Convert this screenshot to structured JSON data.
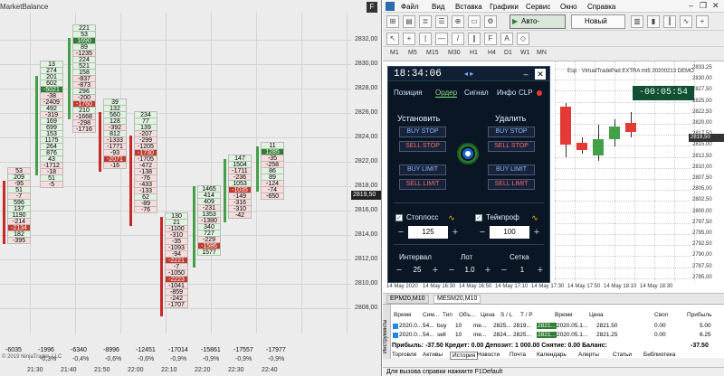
{
  "left_chart": {
    "title": "MarketBalance",
    "f_button": "F",
    "price_axis": [
      "2832,00",
      "2830,00",
      "2828,00",
      "2826,00",
      "2824,00",
      "2822,00",
      "2818,00",
      "2816,00",
      "2814,00",
      "2812,00",
      "2810,00",
      "2808,00"
    ],
    "current_price": "2819,50",
    "columns": [
      {
        "cells": [
          {
            "v": "53",
            "t": "n"
          },
          {
            "v": "209",
            "t": "p"
          },
          {
            "v": "-95",
            "t": "n"
          },
          {
            "v": "51",
            "t": "p"
          },
          {
            "v": "-7",
            "t": "n"
          },
          {
            "v": "596",
            "t": "p"
          },
          {
            "v": "137",
            "t": "p"
          },
          {
            "v": "1190",
            "t": "p"
          },
          {
            "v": "-214",
            "t": "n"
          },
          {
            "v": "-2134",
            "t": "hr"
          },
          {
            "v": "182",
            "t": "p"
          },
          {
            "v": "-395",
            "t": "n"
          }
        ]
      },
      {
        "cells": [
          {
            "v": "13",
            "t": "p"
          },
          {
            "v": "274",
            "t": "p"
          },
          {
            "v": "201",
            "t": "p"
          },
          {
            "v": "602",
            "t": "p"
          },
          {
            "v": "-5021",
            "t": "hg"
          },
          {
            "v": "-38",
            "t": "n"
          },
          {
            "v": "-2409",
            "t": "n"
          },
          {
            "v": "492",
            "t": "p"
          },
          {
            "v": "-319",
            "t": "n"
          },
          {
            "v": "169",
            "t": "p"
          },
          {
            "v": "699",
            "t": "p"
          },
          {
            "v": "153",
            "t": "p"
          },
          {
            "v": "1175",
            "t": "p"
          },
          {
            "v": "264",
            "t": "p"
          },
          {
            "v": "876",
            "t": "p"
          },
          {
            "v": "43",
            "t": "p"
          },
          {
            "v": "-1712",
            "t": "n"
          },
          {
            "v": "-18",
            "t": "n"
          },
          {
            "v": "51",
            "t": "p"
          },
          {
            "v": "-5",
            "t": "n"
          }
        ]
      },
      {
        "cells": [
          {
            "v": "221",
            "t": "p"
          },
          {
            "v": "53",
            "t": "p"
          },
          {
            "v": "1690",
            "t": "hg"
          },
          {
            "v": "89",
            "t": "p"
          },
          {
            "v": "-1235",
            "t": "n"
          },
          {
            "v": "224",
            "t": "p"
          },
          {
            "v": "521",
            "t": "p"
          },
          {
            "v": "158",
            "t": "p"
          },
          {
            "v": "-837",
            "t": "n"
          },
          {
            "v": "-873",
            "t": "n"
          },
          {
            "v": "296",
            "t": "p"
          },
          {
            "v": "-200",
            "t": "n"
          },
          {
            "v": "-1760",
            "t": "hr"
          },
          {
            "v": "210",
            "t": "p"
          },
          {
            "v": "-1668",
            "t": "n"
          },
          {
            "v": "-298",
            "t": "n"
          },
          {
            "v": "-1716",
            "t": "n"
          }
        ]
      },
      {
        "cells": [
          {
            "v": "39",
            "t": "p"
          },
          {
            "v": "132",
            "t": "p"
          },
          {
            "v": "560",
            "t": "p"
          },
          {
            "v": "128",
            "t": "p"
          },
          {
            "v": "-392",
            "t": "n"
          },
          {
            "v": "812",
            "t": "p"
          },
          {
            "v": "-1333",
            "t": "n"
          },
          {
            "v": "-1771",
            "t": "n"
          },
          {
            "v": "-93",
            "t": "n"
          },
          {
            "v": "-2071",
            "t": "hr"
          },
          {
            "v": "-16",
            "t": "n"
          }
        ]
      },
      {
        "cells": [
          {
            "v": "234",
            "t": "p"
          },
          {
            "v": "77",
            "t": "p"
          },
          {
            "v": "139",
            "t": "p"
          },
          {
            "v": "-207",
            "t": "n"
          },
          {
            "v": "-299",
            "t": "n"
          },
          {
            "v": "-1205",
            "t": "n"
          },
          {
            "v": "-1730",
            "t": "hr"
          },
          {
            "v": "-1705",
            "t": "n"
          },
          {
            "v": "-472",
            "t": "n"
          },
          {
            "v": "-138",
            "t": "n"
          },
          {
            "v": "-76",
            "t": "n"
          },
          {
            "v": "-433",
            "t": "n"
          },
          {
            "v": "-133",
            "t": "n"
          },
          {
            "v": "62",
            "t": "p"
          },
          {
            "v": "-89",
            "t": "n"
          },
          {
            "v": "-76",
            "t": "n"
          }
        ]
      },
      {
        "cells": [
          {
            "v": "130",
            "t": "p"
          },
          {
            "v": "21",
            "t": "p"
          },
          {
            "v": "-1100",
            "t": "n"
          },
          {
            "v": "-310",
            "t": "n"
          },
          {
            "v": "-35",
            "t": "n"
          },
          {
            "v": "-1093",
            "t": "n"
          },
          {
            "v": "-94",
            "t": "n"
          },
          {
            "v": "-2221",
            "t": "hr"
          },
          {
            "v": "-7",
            "t": "n"
          },
          {
            "v": "-1050",
            "t": "n"
          },
          {
            "v": "-2223",
            "t": "hr"
          },
          {
            "v": "-1041",
            "t": "n"
          },
          {
            "v": "-859",
            "t": "n"
          },
          {
            "v": "-242",
            "t": "n"
          },
          {
            "v": "-1707",
            "t": "n"
          }
        ]
      },
      {
        "cells": [
          {
            "v": "1465",
            "t": "p"
          },
          {
            "v": "414",
            "t": "p"
          },
          {
            "v": "409",
            "t": "p"
          },
          {
            "v": "-231",
            "t": "n"
          },
          {
            "v": "1353",
            "t": "p"
          },
          {
            "v": "-1380",
            "t": "n"
          },
          {
            "v": "340",
            "t": "p"
          },
          {
            "v": "727",
            "t": "p"
          },
          {
            "v": "-229",
            "t": "n"
          },
          {
            "v": "-1586",
            "t": "hr"
          },
          {
            "v": "1577",
            "t": "p"
          }
        ]
      },
      {
        "cells": [
          {
            "v": "147",
            "t": "p"
          },
          {
            "v": "1504",
            "t": "p"
          },
          {
            "v": "-1711",
            "t": "n"
          },
          {
            "v": "-236",
            "t": "n"
          },
          {
            "v": "1053",
            "t": "p"
          },
          {
            "v": "-1035",
            "t": "hr"
          },
          {
            "v": "-149",
            "t": "n"
          },
          {
            "v": "-316",
            "t": "n"
          },
          {
            "v": "-310",
            "t": "n"
          },
          {
            "v": "-42",
            "t": "n"
          }
        ]
      },
      {
        "cells": [
          {
            "v": "11",
            "t": "p"
          },
          {
            "v": "1285",
            "t": "hg"
          },
          {
            "v": "-35",
            "t": "n"
          },
          {
            "v": "-258",
            "t": "n"
          },
          {
            "v": "86",
            "t": "p"
          },
          {
            "v": "89",
            "t": "p"
          },
          {
            "v": "-124",
            "t": "n"
          },
          {
            "v": "-74",
            "t": "n"
          },
          {
            "v": "-650",
            "t": "n"
          }
        ]
      }
    ],
    "bottom_values": [
      "-6035",
      "-1996",
      "-6340",
      "-8996",
      "-12451",
      "-17014",
      "-15861",
      "-17557",
      "-17977"
    ],
    "bottom_percents": [
      "-0,3%",
      "-0,4%",
      "-0,6%",
      "-0,6%",
      "-0,9%",
      "-0,9%",
      "-0,9%",
      "-0,9%"
    ],
    "time_labels": [
      "21:30",
      "21:40",
      "21:50",
      "22:00",
      "22:10",
      "22:20",
      "22:30",
      "22:40"
    ],
    "copyright": "© 2019 NinjaTrader, LLC"
  },
  "right": {
    "menu": [
      "Файл",
      "Вид",
      "Вставка",
      "Графики",
      "Сервис",
      "Окно",
      "Справка"
    ],
    "auto_trading": "Авто-торговля",
    "new_order": "Новый ордер",
    "timeframes": [
      "M1",
      "M5",
      "M15",
      "M30",
      "H1",
      "H4",
      "D1",
      "W1",
      "MN"
    ],
    "chart_label": "Esp · VirtualTradePad EXTRA mt5 20200213 DEMO",
    "countdown": "-00:05:54",
    "price_axis": [
      "2833,25",
      "2830,00",
      "2827,50",
      "2825,00",
      "2822,50",
      "2820,00",
      "2817,50",
      "2815,00",
      "2812,50",
      "2810,00",
      "2807,50",
      "2805,00",
      "2802,50",
      "2800,00",
      "2797,50",
      "2795,00",
      "2792,50",
      "2790,00",
      "2787,50",
      "2785,00"
    ],
    "price_mark": "2819,50",
    "dates": [
      "14 May 2020",
      "14 May 16:30",
      "14 May 16:50",
      "14 May 17:10",
      "14 May 17:30",
      "14 May 17:50",
      "14 May 18:10",
      "14 May 18:30"
    ],
    "chart_tabs": [
      "EPM20,M10",
      "MESM20,M10"
    ],
    "panel": {
      "time": "18:34:06",
      "arrows": "◂  ▸",
      "min": "–",
      "close": "✕",
      "tabs": [
        "Позиция",
        "Ордер",
        "Сигнал",
        "Инфо",
        "CLP"
      ],
      "install_label": "Установить",
      "delete_label": "Удалить",
      "buy_stop": "BUY STOP",
      "sell_stop": "SELL STOP",
      "buy_limit": "BUY LIMIT",
      "sell_limit": "SELL LIMIT",
      "stoploss_label": "Стоплосс",
      "takeprofit_label": "Тейкпроф",
      "stoploss_value": "125",
      "takeprofit_value": "100",
      "interval_label": "Интервал",
      "lot_label": "Лот",
      "grid_label": "Сетка",
      "interval_value": "25",
      "lot_value": "1.0",
      "grid_value": "1",
      "minus": "−",
      "plus": "+"
    },
    "terminal": {
      "side_label": "Инструменты",
      "headers": [
        "Время",
        "Сим...",
        "Тип",
        "Объ...",
        "Цена",
        "S / L",
        "T / P",
        "Время",
        "Цена",
        "Своп",
        "Прибыль"
      ],
      "rows": [
        [
          "2020.0...",
          "54...",
          "buy",
          "10",
          "me...",
          "2825...",
          "2819...",
          "2821...",
          "2020.05.1...",
          "2821.50",
          "0.00",
          "5.00"
        ],
        [
          "2020.0...",
          "54...",
          "sell",
          "10",
          "me...",
          "2824...",
          "2825...",
          "2821...",
          "2020.05.1...",
          "2821.25",
          "0.00",
          "6.25"
        ]
      ],
      "summary": "Прибыль: -37.50  Кредит: 0.00  Депозит: 1 000.00  Снятие: 0.00  Баланс:",
      "summary_right": "-37.50",
      "tabs": [
        "Торговля",
        "Активы",
        "История",
        "Новости",
        "Почта",
        "Календарь",
        "Алерты",
        "Статьи",
        "Библиотека"
      ]
    },
    "status": "Для вызова справки нажмите F1",
    "status_right": "Default"
  }
}
